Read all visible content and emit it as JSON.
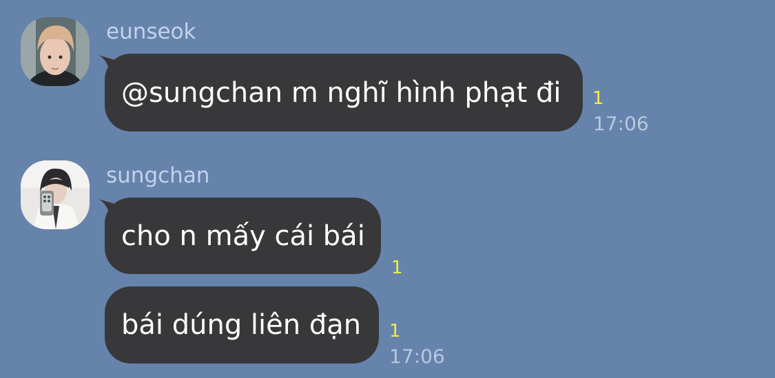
{
  "colors": {
    "background": "#6683ac",
    "bubble": "#38383a",
    "bubble_text": "#ffffff",
    "sender_name": "#c4d2e8",
    "unread": "#f4ef3c",
    "timestamp": "#b9c8df"
  },
  "groups": [
    {
      "sender": "eunseok",
      "avatar_icon": "profile-photo",
      "messages": [
        {
          "text": "@sungchan m nghĩ hình phạt đi",
          "unread": "1",
          "time": "17:06"
        }
      ]
    },
    {
      "sender": "sungchan",
      "avatar_icon": "profile-photo",
      "messages": [
        {
          "text": "cho n mấy cái bái",
          "unread": "1",
          "time": ""
        },
        {
          "text": "bái dúng liên đạn",
          "unread": "1",
          "time": "17:06"
        }
      ]
    }
  ]
}
